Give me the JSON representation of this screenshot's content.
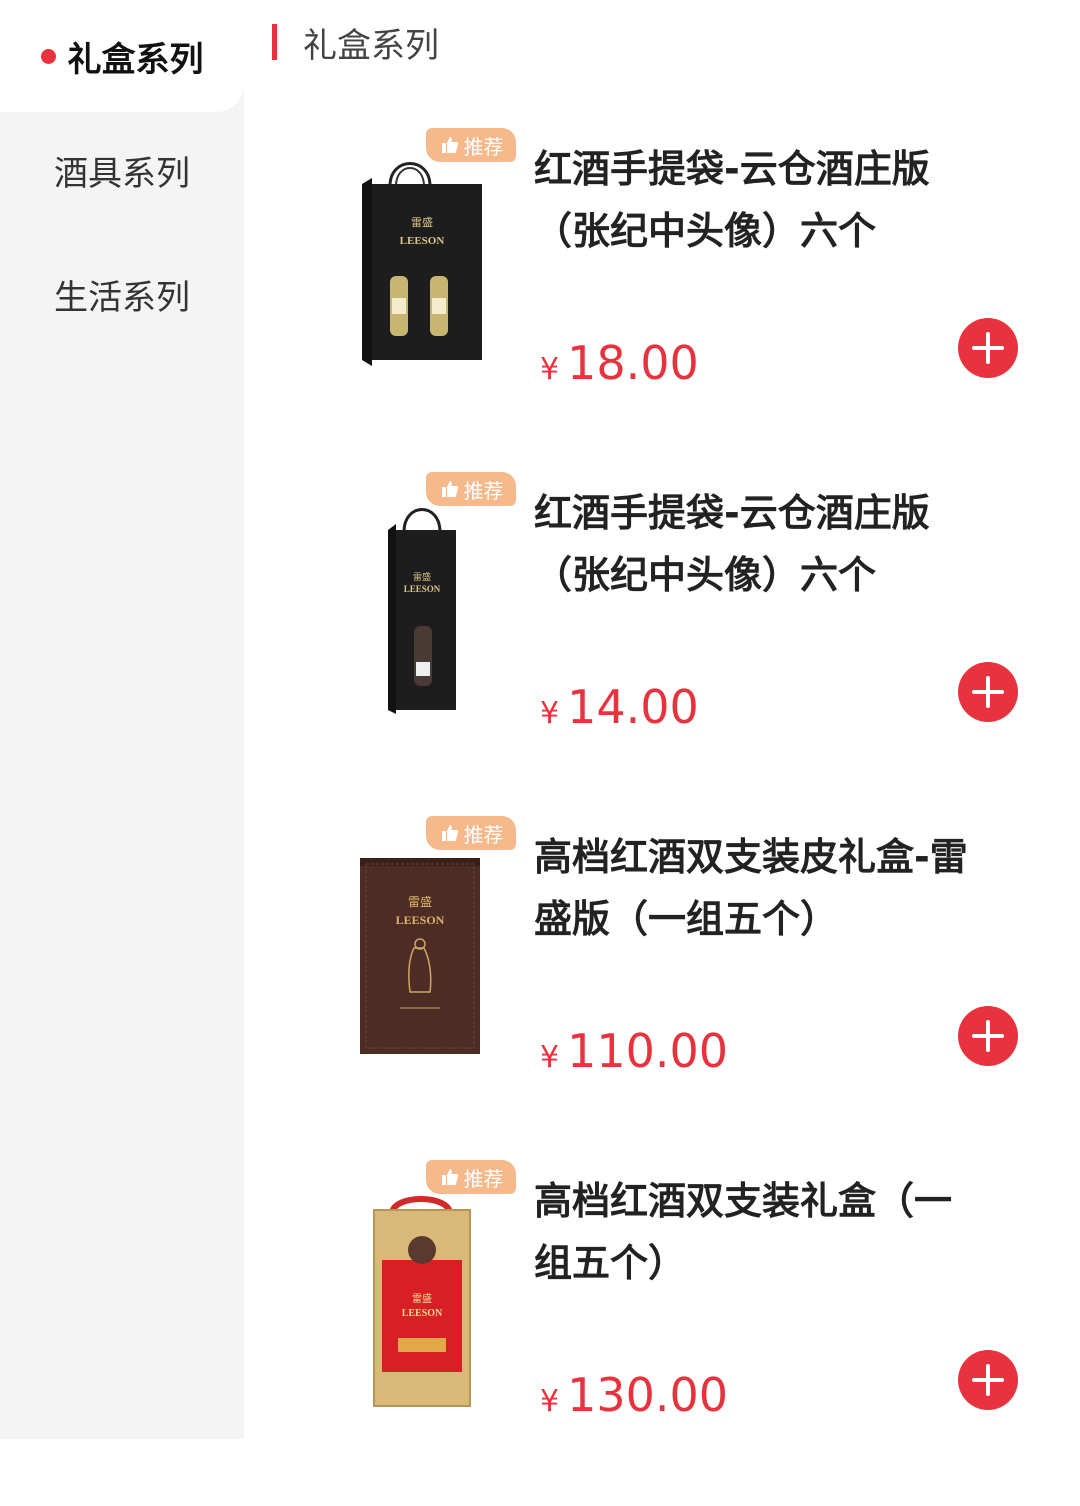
{
  "sidebar": {
    "items": [
      {
        "label": "礼盒系列",
        "active": true
      },
      {
        "label": "酒具系列",
        "active": false
      },
      {
        "label": "生活系列",
        "active": false
      }
    ]
  },
  "section": {
    "title": "礼盒系列"
  },
  "products": [
    {
      "badge": "推荐",
      "title": "红酒手提袋-云仓酒庄版\n（张纪中头像）六个",
      "currency": "¥",
      "price": "18.00",
      "image": "two-bottle-black-paper-bag",
      "brand": "雷盛 LEESON"
    },
    {
      "badge": "推荐",
      "title": "红酒手提袋-云仓酒庄版\n（张纪中头像）六个",
      "currency": "¥",
      "price": "14.00",
      "image": "single-bottle-black-paper-bag",
      "brand": "雷盛 LEESON"
    },
    {
      "badge": "推荐",
      "title": "高档红酒双支装皮礼盒-雷\n盛版（一组五个）",
      "currency": "¥",
      "price": "110.00",
      "image": "brown-leather-gift-box",
      "brand": "雷盛 LEESON"
    },
    {
      "badge": "推荐",
      "title": "高档红酒双支装礼盒（一\n组五个）",
      "currency": "¥",
      "price": "130.00",
      "image": "red-gold-gift-box",
      "brand": "雷盛 LEESON"
    }
  ],
  "colors": {
    "accent": "#e8333f",
    "badge": "#f5b98b",
    "sidebar_bg": "#f4f4f4"
  }
}
